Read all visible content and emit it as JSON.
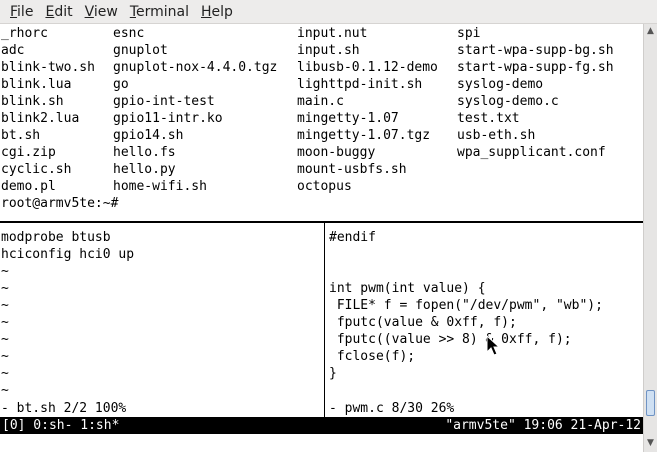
{
  "menu": [
    "File",
    "Edit",
    "View",
    "Terminal",
    "Help"
  ],
  "menu_mnemonics": [
    "F",
    "E",
    "V",
    "T",
    "H"
  ],
  "ls_columns": [
    [
      "_rhorc",
      "adc",
      "blink-two.sh",
      "blink.lua",
      "blink.sh",
      "blink2.lua",
      "bt.sh",
      "cgi.zip",
      "cyclic.sh",
      "demo.pl"
    ],
    [
      "esnc",
      "gnuplot",
      "gnuplot-nox-4.4.0.tgz",
      "go",
      "gpio-int-test",
      "gpio11-intr.ko",
      "gpio14.sh",
      "hello.fs",
      "hello.py",
      "home-wifi.sh"
    ],
    [
      "input.nut",
      "input.sh",
      "libusb-0.1.12-demo",
      "lighttpd-init.sh",
      "main.c",
      "mingetty-1.07",
      "mingetty-1.07.tgz",
      "moon-buggy",
      "mount-usbfs.sh",
      "octopus"
    ],
    [
      "spi",
      "start-wpa-supp-bg.sh",
      "start-wpa-supp-fg.sh",
      "syslog-demo",
      "syslog-demo.c",
      "test.txt",
      "usb-eth.sh",
      "wpa_supplicant.conf"
    ]
  ],
  "prompt": "root@armv5te:~#",
  "left_pane": {
    "lines": [
      "modprobe btusb",
      "hciconfig hci0 up",
      "~",
      "~",
      "~",
      "~",
      "~",
      "~",
      "~",
      "~"
    ],
    "status": "- bt.sh 2/2 100%"
  },
  "right_pane": {
    "lines": [
      "#endif",
      "",
      "",
      "int pwm(int value) {",
      " FILE* f = fopen(\"/dev/pwm\", \"wb\");",
      " fputc(value & 0xff, f);",
      " fputc((value >> 8) & 0xff, f);",
      " fclose(f);",
      "}",
      ""
    ],
    "status": "- pwm.c 8/30 26%"
  },
  "tmux": {
    "left": "[0] 0:sh- 1:sh*",
    "right": "\"armv5te\" 19:06 21-Apr-12"
  }
}
